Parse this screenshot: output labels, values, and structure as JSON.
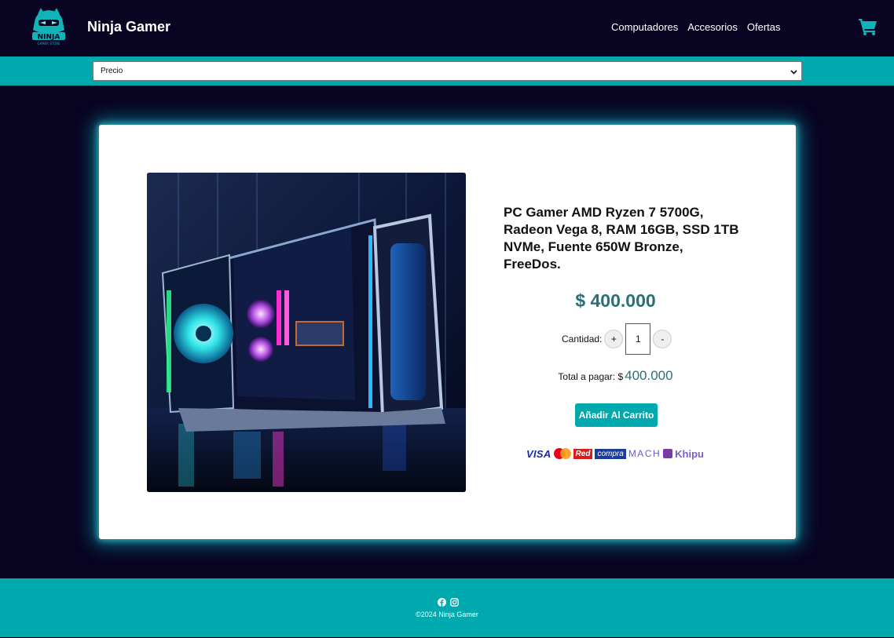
{
  "header": {
    "brand": "Ninja Gamer",
    "logo_text": "NINJA",
    "logo_subtext": "GAMER STORE",
    "nav": [
      "Computadores",
      "Accesorios",
      "Ofertas"
    ],
    "cart_icon": "shopping-cart-icon"
  },
  "filter": {
    "selected": "Precio"
  },
  "product": {
    "title": "PC Gamer AMD Ryzen 7 5700G, Radeon Vega 8, RAM 16GB, SSD 1TB NVMe, Fuente 650W Bronze, FreeDos.",
    "price": "$ 400.000",
    "quantity_label": "Cantidad:",
    "increment_label": "+",
    "quantity": "1",
    "decrement_label": "-",
    "total_label": "Total a pagar: $",
    "total_value": "400.000",
    "add_to_cart": "Añadir Al Carrito"
  },
  "payments": {
    "visa": "VISA",
    "redcompra_red": "Red",
    "redcompra_compra": "compra",
    "mach": "MACH",
    "khipu": "Khipu"
  },
  "footer": {
    "icons": [
      "facebook-icon",
      "instagram-icon"
    ],
    "copyright": "©2024 Ninja Gamer"
  },
  "colors": {
    "background": "#080422",
    "accent": "#00a9ae",
    "price": "#2a6f77"
  }
}
